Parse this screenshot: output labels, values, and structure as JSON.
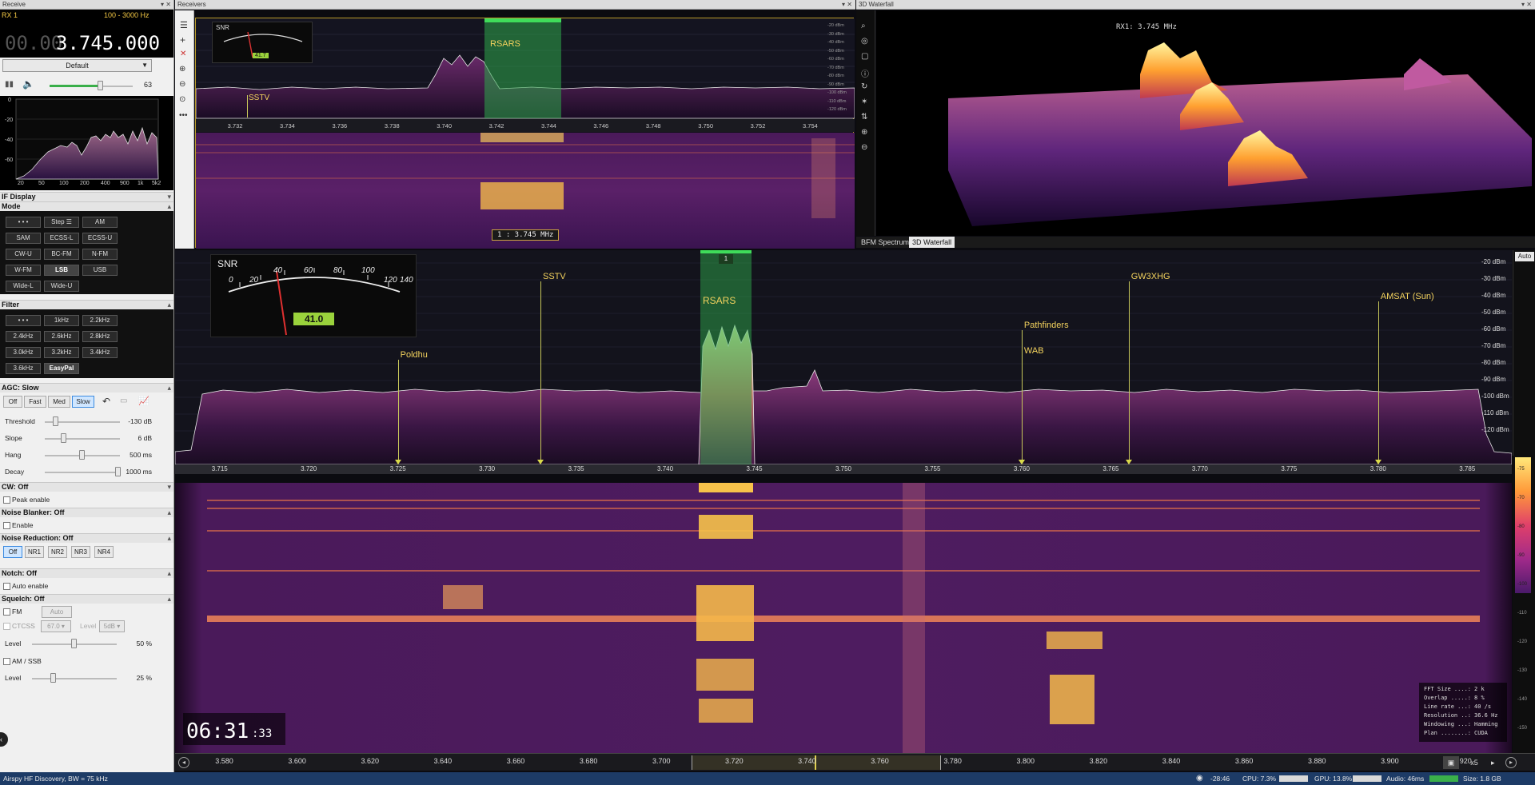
{
  "receive_panel": {
    "title": "Receive",
    "rx_label": "RX 1",
    "bandwidth": "100 - 3000 Hz",
    "freq_dim": "00.00",
    "freq_main": "3.745.000",
    "preset": "Default",
    "volume": "63",
    "volume_level": 0.63,
    "audio_axis_x": [
      "20",
      "50",
      "100",
      "200",
      "400",
      "900",
      "1k",
      "5k2"
    ],
    "audio_axis_y": [
      "0",
      "-20",
      "-40",
      "-60"
    ],
    "sections": {
      "if_display": "IF Display",
      "mode": "Mode",
      "filter": "Filter",
      "agc": "AGC: Slow",
      "cw": "CW: Off",
      "nb": "Noise Blanker: Off",
      "nr": "Noise Reduction: Off",
      "notch": "Notch: Off",
      "squelch": "Squelch: Off"
    },
    "mode_buttons": [
      "• • •",
      "Step ☰",
      "AM",
      "SAM",
      "ECSS-L",
      "ECSS-U",
      "CW-U",
      "BC-FM",
      "N-FM",
      "W-FM",
      "LSB",
      "USB",
      "Wide-L",
      "Wide-U"
    ],
    "mode_selected": "LSB",
    "filter_buttons": [
      "• • •",
      "1kHz",
      "2.2kHz",
      "2.4kHz",
      "2.6kHz",
      "2.8kHz",
      "3.0kHz",
      "3.2kHz",
      "3.4kHz",
      "3.6kHz",
      "EasyPal"
    ],
    "filter_selected": "EasyPal",
    "agc_buttons": [
      "Off",
      "Fast",
      "Med",
      "Slow"
    ],
    "agc_selected": "Slow",
    "agc_sliders": [
      {
        "label": "Threshold",
        "value": "-130 dB",
        "level": 0.15
      },
      {
        "label": "Slope",
        "value": "6 dB",
        "level": 0.25
      },
      {
        "label": "Hang",
        "value": "500 ms",
        "level": 0.5
      },
      {
        "label": "Decay",
        "value": "1000 ms",
        "level": 0.98
      }
    ],
    "cw_peak": "Peak enable",
    "nb_enable": "Enable",
    "nr_buttons": [
      "Off",
      "NR1",
      "NR2",
      "NR3",
      "NR4"
    ],
    "nr_selected": "Off",
    "notch_auto": "Auto enable",
    "squelch": {
      "fm": "FM",
      "auto": "Auto",
      "ctcss": "CTCSS",
      "ctcss_value": "67.0",
      "level_short": "Level",
      "level_value_short": "5dB",
      "level1_label": "Level",
      "level1_value": "50 %",
      "level1": 0.5,
      "am_ssb": "AM / SSB",
      "level2_label": "Level",
      "level2_value": "25 %",
      "level2": 0.25
    }
  },
  "receivers_panel": {
    "title": "Receivers",
    "snr_label": "SNR",
    "snr_value": "41.7",
    "snr_scale": [
      "0",
      "20",
      "40",
      "60",
      "80",
      "100",
      "120",
      "140"
    ],
    "freq_ticks": [
      "3.732",
      "3.734",
      "3.736",
      "3.738",
      "3.740",
      "3.742",
      "3.744",
      "3.746",
      "3.748",
      "3.750",
      "3.752",
      "3.754"
    ],
    "db_ticks": [
      "-20 dBm",
      "-30 dBm",
      "-40 dBm",
      "-50 dBm",
      "-60 dBm",
      "-70 dBm",
      "-80 dBm",
      "-90 dBm",
      "-100 dBm",
      "-110 dBm",
      "-120 dBm"
    ],
    "rsars": "RSARS",
    "sstv": "SSTV",
    "tooltip": "1 : 3.745 MHz"
  },
  "waterfall3d_panel": {
    "title": "3D Waterfall",
    "rx_label": "RX1: 3.745 MHz",
    "tabs": [
      "BFM Spectrum",
      "3D Waterfall"
    ],
    "active_tab": "3D Waterfall"
  },
  "main_spectrum": {
    "snr_label": "SNR",
    "snr_value": "41.0",
    "snr_scale": [
      "0",
      "20",
      "40",
      "60",
      "80",
      "100",
      "120",
      "140"
    ],
    "db_ticks": [
      "-20 dBm",
      "-30 dBm",
      "-40 dBm",
      "-50 dBm",
      "-60 dBm",
      "-70 dBm",
      "-80 dBm",
      "-90 dBm",
      "-100 dBm",
      "-110 dBm",
      "-120 dBm"
    ],
    "freq_ticks": [
      "3.715",
      "3.720",
      "3.725",
      "3.730",
      "3.735",
      "3.740",
      "3.745",
      "3.750",
      "3.755",
      "3.760",
      "3.765",
      "3.770",
      "3.775",
      "3.780",
      "3.785"
    ],
    "auto_label": "Auto",
    "rx_number": "1",
    "markers": [
      {
        "label": "Poldhu",
        "freq": 3.725
      },
      {
        "label": "SSTV",
        "freq": 3.733
      },
      {
        "label": "Pathfinders",
        "freq": 3.76
      },
      {
        "label": "WAB",
        "freq": 3.76
      },
      {
        "label": "GW3XHG",
        "freq": 3.766
      },
      {
        "label": "AMSAT (Sun)",
        "freq": 3.78
      }
    ],
    "rsars": "RSARS"
  },
  "main_waterfall": {
    "clock_main": "06:31",
    "clock_sec": ":33",
    "stats": [
      [
        "FFT Size ....:",
        "2 k"
      ],
      [
        "Overlap .....:",
        "8 %"
      ],
      [
        "Line rate ...:",
        "40 /s"
      ],
      [
        "Resolution ..:",
        "36.6 Hz"
      ],
      [
        "Windowing ...:",
        "Hamming"
      ],
      [
        "Plan ........:",
        "CUDA"
      ]
    ],
    "scale_ticks": [
      "-75",
      "-70",
      "-80",
      "-90",
      "-100",
      "-110",
      "-120",
      "-130",
      "-140",
      "-150"
    ],
    "freq_ticks": [
      "3.580",
      "3.600",
      "3.620",
      "3.640",
      "3.660",
      "3.680",
      "3.700",
      "3.720",
      "3.740",
      "3.760",
      "3.780",
      "3.800",
      "3.820",
      "3.840",
      "3.860",
      "3.880",
      "3.900",
      "3.920"
    ],
    "zoom": "x5"
  },
  "status": {
    "device": "Airspy HF Discovery, BW = 75 kHz",
    "time": "-28:46",
    "cpu": "CPU: 7.3%",
    "gpu": "GPU: 13.8%",
    "audio": "Audio: 46ms",
    "size": "Size: 1.8 GB"
  }
}
